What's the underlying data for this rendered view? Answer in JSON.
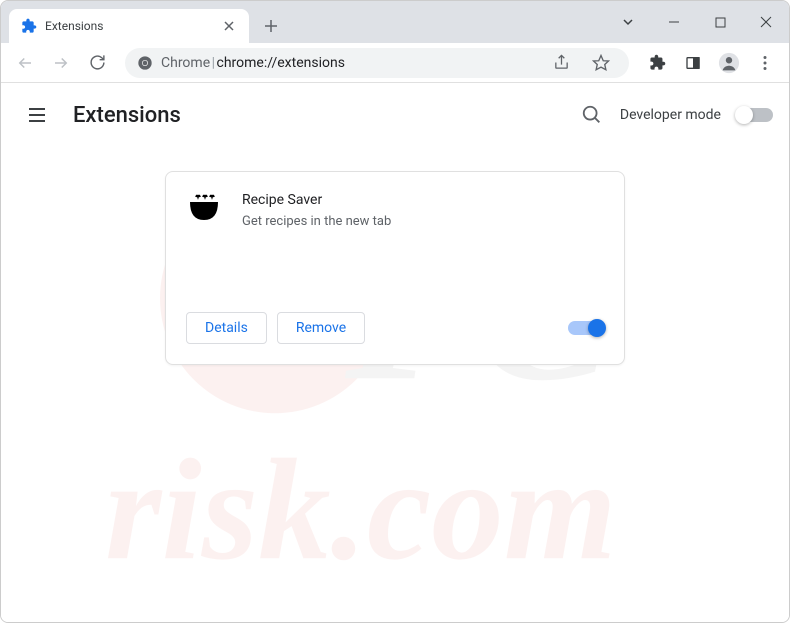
{
  "browser": {
    "tab": {
      "title": "Extensions"
    },
    "omnibox": {
      "prefix": "Chrome",
      "path": "chrome://extensions"
    }
  },
  "page": {
    "title": "Extensions",
    "developer_mode_label": "Developer mode"
  },
  "extension": {
    "name": "Recipe Saver",
    "description": "Get recipes in the new tab",
    "buttons": {
      "details": "Details",
      "remove": "Remove"
    }
  }
}
